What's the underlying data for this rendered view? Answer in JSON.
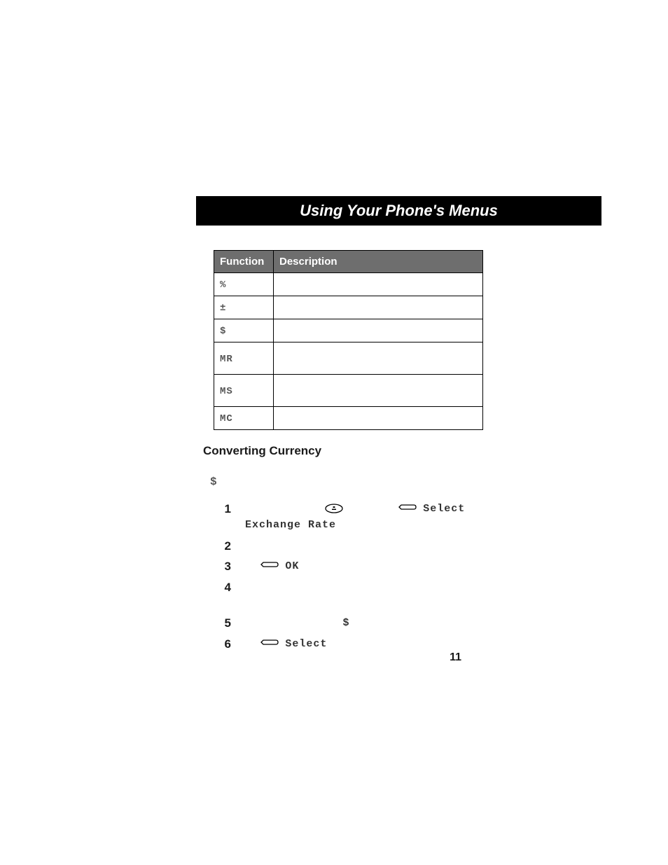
{
  "title": "Using Your Phone's Menus",
  "table": {
    "headers": {
      "col1": "Function",
      "col2": "Description"
    },
    "rows": [
      {
        "fn": "%",
        "desc": ""
      },
      {
        "fn": "±",
        "desc": ""
      },
      {
        "fn": "$",
        "desc": ""
      },
      {
        "fn": "MR",
        "desc": ""
      },
      {
        "fn": "MS",
        "desc": ""
      },
      {
        "fn": "MC",
        "desc": ""
      }
    ]
  },
  "section_heading": "Converting Currency",
  "currency_symbol": "$",
  "select_label": "Select",
  "ok_label": "OK",
  "exchange_rate_label": "Exchange Rate",
  "steps": {
    "s1_num": "1",
    "s2_num": "2",
    "s3_num": "3",
    "s4_num": "4",
    "s5_num": "5",
    "s6_num": "6"
  },
  "inline_dollar": "$",
  "page_number": "11"
}
